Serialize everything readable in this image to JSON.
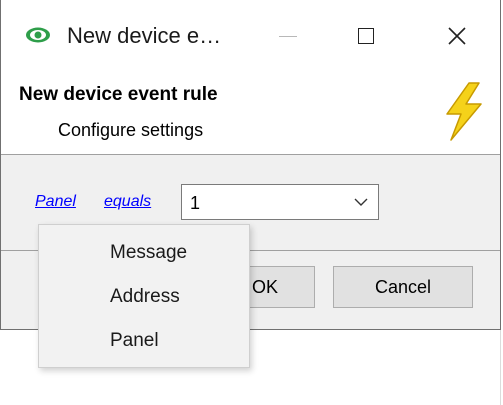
{
  "window": {
    "title": "New device e…",
    "controls": {
      "minimize": "—",
      "maximize": "☐",
      "close": "✕"
    }
  },
  "header": {
    "title": "New device event rule",
    "subtitle": "Configure settings",
    "icon": "lightning-bolt-icon"
  },
  "rule": {
    "field_link": "Panel",
    "operator_link": "equals",
    "value": "1"
  },
  "buttons": {
    "ok": "OK",
    "cancel": "Cancel"
  },
  "dropdown_menu": {
    "items": [
      "Message",
      "Address",
      "Panel"
    ]
  },
  "colors": {
    "link": "#0000ff",
    "app_icon": "#2e9e4a",
    "bolt": "#f5d21a"
  }
}
